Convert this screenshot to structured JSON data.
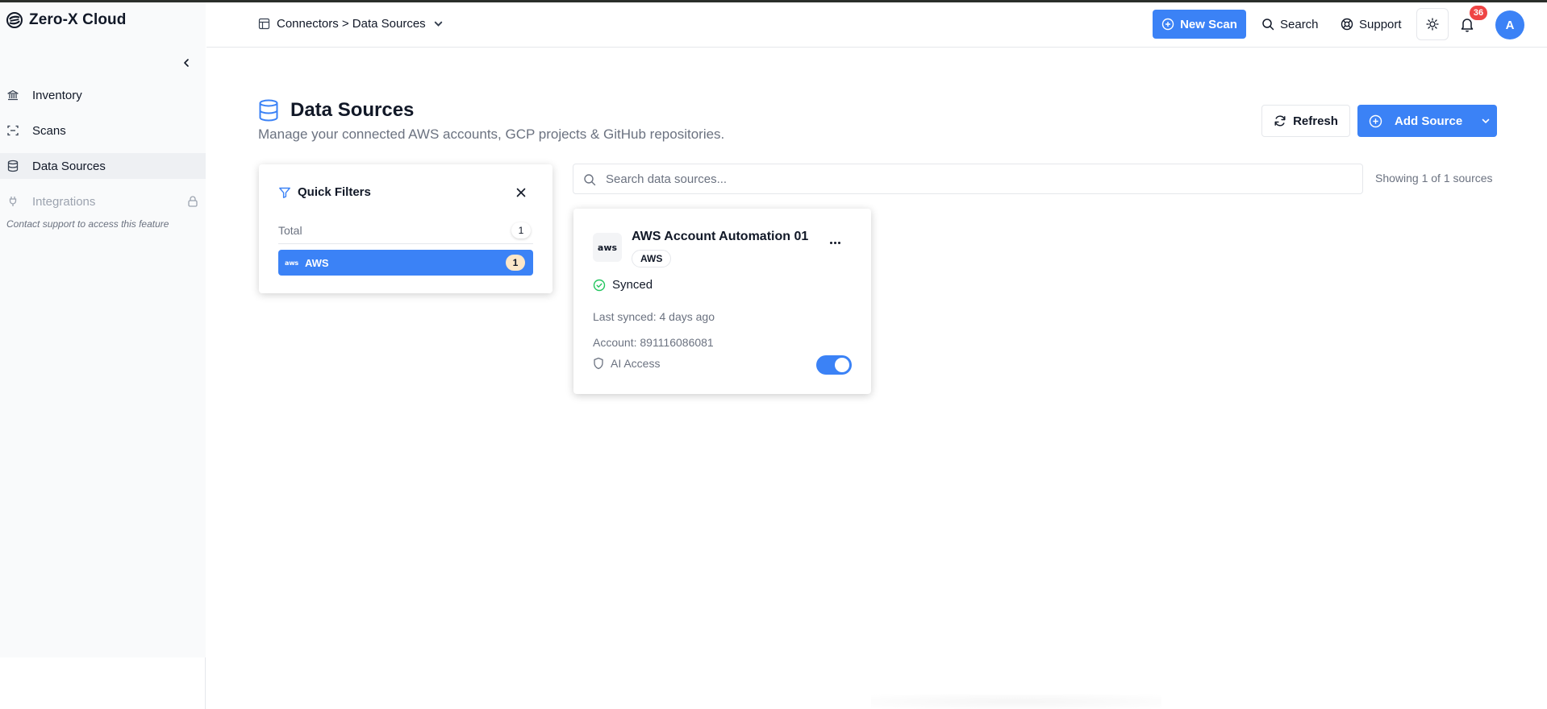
{
  "app": {
    "name": "Zero-X Cloud"
  },
  "sidebar": {
    "items": [
      {
        "label": "Inventory",
        "icon": "bank-icon"
      },
      {
        "label": "Scans",
        "icon": "scan-icon"
      },
      {
        "label": "Data Sources",
        "icon": "database-icon",
        "active": true
      },
      {
        "label": "Integrations",
        "icon": "plug-icon",
        "locked": true
      }
    ],
    "locked_note": "Contact support to access this feature"
  },
  "header": {
    "breadcrumb": "Connectors > Data Sources",
    "new_scan_label": "New Scan",
    "search_label": "Search",
    "support_label": "Support",
    "notification_count": "36",
    "avatar_initial": "A"
  },
  "page": {
    "title": "Data Sources",
    "subtitle": "Manage your connected AWS accounts, GCP projects & GitHub repositories.",
    "refresh_label": "Refresh",
    "add_source_label": "Add Source"
  },
  "quick_filters": {
    "title": "Quick Filters",
    "total_label": "Total",
    "total_count": "1",
    "items": [
      {
        "label": "AWS",
        "count": "1",
        "selected": true
      }
    ]
  },
  "search": {
    "placeholder": "Search data sources...",
    "value": "",
    "showing_text": "Showing 1 of 1 sources"
  },
  "sources": [
    {
      "logo_text": "aws",
      "name": "AWS Account Automation 01",
      "provider_tag": "AWS",
      "status": "Synced",
      "last_synced": "Last synced: 4 days ago",
      "account": "Account: 891116086081",
      "ai_access_label": "AI Access",
      "ai_access_enabled": true
    }
  ],
  "colors": {
    "accent": "#3b82f6",
    "badge": "#ef4444",
    "success": "#22c55e",
    "count_highlight": "#fde7c8"
  }
}
